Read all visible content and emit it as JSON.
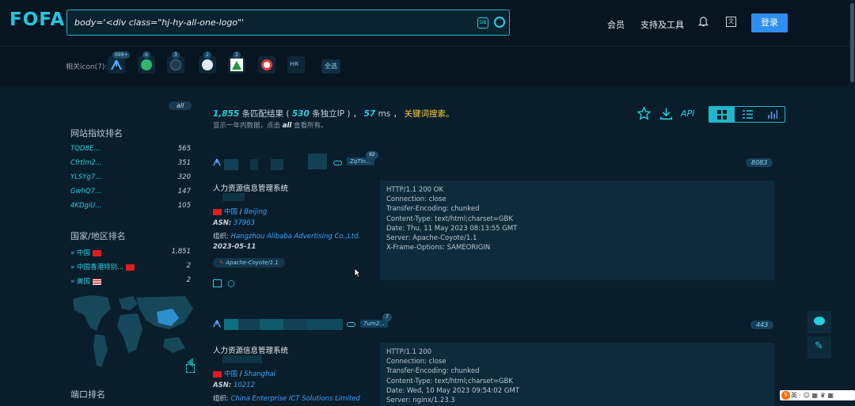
{
  "header": {
    "logo": "FOFA",
    "query": "body='<div class=\"hj-hy-all-one-logo\"'",
    "nav_member": "会员",
    "nav_tools": "支持及工具",
    "login": "登录",
    "search_icon_label": "DB"
  },
  "icon_row": {
    "label": "相关icon(7):",
    "badges": [
      "999+",
      "6",
      "3",
      "2",
      "2"
    ],
    "select_all": "全选",
    "icons": [
      "fofa-arrow-icon",
      "leaf-icon",
      "car-icon",
      "p-circle-icon",
      "mountain-icon",
      "bird-icon",
      "hr-icon"
    ]
  },
  "sidebar": {
    "all": "all",
    "fingerprint_title": "网站指纹排名",
    "fingerprints": [
      {
        "name": "TQD8E...",
        "count": "565"
      },
      {
        "name": "Cfrtlm2...",
        "count": "351"
      },
      {
        "name": "YLSYg7...",
        "count": "320"
      },
      {
        "name": "GwhQ7...",
        "count": "147"
      },
      {
        "name": "4KDgiU...",
        "count": "105"
      }
    ],
    "country_title": "国家/地区排名",
    "countries": [
      {
        "name": "中国",
        "count": "1,851"
      },
      {
        "name": "中国香港特别...",
        "count": "2"
      },
      {
        "name": "美国",
        "count": "2"
      }
    ],
    "port_title": "端口排名"
  },
  "results": {
    "count": "1,855",
    "t1": "条匹配结果 (",
    "unique": "530",
    "t2": "条独立IP ) ，",
    "ms": "57",
    "t3": "ms ，",
    "keyword": "关键词搜索。",
    "sub": "显示一年内数据，点击",
    "sub_all": "all",
    "sub2": "查看所有。",
    "api": "API"
  },
  "cards": [
    {
      "tag": "ZqTln...",
      "tag_num": "92",
      "port": "8083",
      "title": "人力资源信息管理系统",
      "country": "中国",
      "city": "Beijing",
      "asn_label": "ASN:",
      "asn": "37963",
      "org_label": "组织:",
      "org": "Hangzhou Alibaba Advertising Co.,Ltd.",
      "date": "2023-05-11",
      "chip": "Apache-Coyote/1.1",
      "banner": [
        "HTTP/1.1 200 OK",
        "Connection: close",
        "Transfer-Encoding: chunked",
        "Content-Type: text/html;charset=GBK",
        "Date: Thu, 11 May 2023 08:13:55 GMT",
        "Server: Apache-Coyote/1.1",
        "X-Frame-Options: SAMEORIGIN"
      ]
    },
    {
      "tag": "7um2...",
      "tag_num": "7",
      "port": "443",
      "title": "人力资源信息管理系统",
      "country": "中国",
      "city": "Shanghai",
      "asn_label": "ASN:",
      "asn": "10212",
      "org_label": "组织:",
      "org": "China Enterprise ICT Solutions Limited",
      "banner": [
        "HTTP/1.1 200",
        "Connection: close",
        "Transfer-Encoding: chunked",
        "Content-Type: text/html;charset=GBK",
        "Date: Wed, 10 May 2023 09:54:02 GMT",
        "Server: nginx/1.23.3"
      ]
    }
  ],
  "ime": {
    "text": "英 · ☺ ▦ ♛ ▦"
  },
  "colors": {
    "accent": "#25d0e2",
    "link": "#3ba5ff",
    "highlight": "#ffd23f",
    "login": "#2e8ff0"
  }
}
